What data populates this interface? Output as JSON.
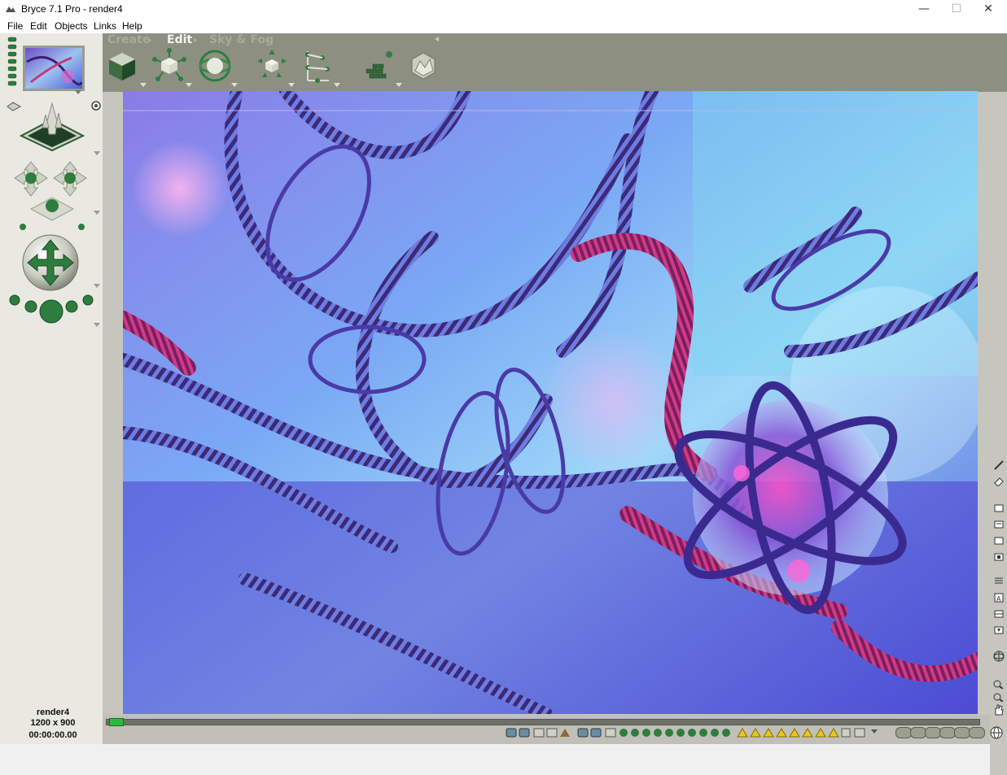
{
  "window": {
    "title": "Bryce 7.1  Pro - render4",
    "minimize_glyph": "—",
    "maximize_glyph": "☐",
    "close_glyph": "✕"
  },
  "menu": [
    "File",
    "Edit",
    "Objects",
    "Links",
    "Help"
  ],
  "tabs": {
    "create": "Create",
    "edit": "Edit",
    "sky_fog": "Sky & Fog"
  },
  "edit_tools": [
    {
      "icon": "material-cube-icon"
    },
    {
      "icon": "resize-icon"
    },
    {
      "icon": "rotate-icon"
    },
    {
      "icon": "reposition-icon"
    },
    {
      "icon": "align-icon"
    },
    {
      "icon": "randomize-icon"
    },
    {
      "icon": "terrain-editor-icon"
    }
  ],
  "document": {
    "name": "render4",
    "size": "1200 x 900",
    "time": "00:00:00.00"
  },
  "colors": {
    "toolbar_bg": "#8d9081",
    "panel_bg": "#e9e9e2",
    "accent_green": "#2e7d3e",
    "timeline_marker": "#2cba3c"
  }
}
